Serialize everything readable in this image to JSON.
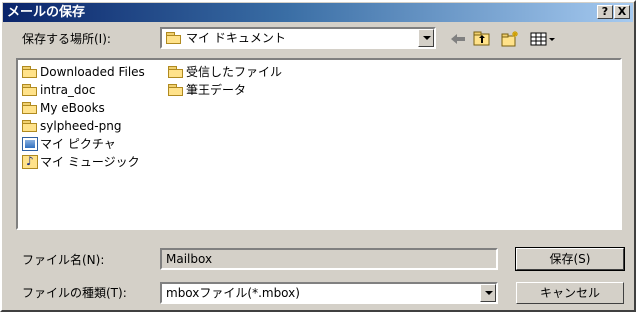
{
  "window": {
    "title": "メールの保存",
    "help_label": "?",
    "close_label": "X"
  },
  "location": {
    "label": "保存する場所(I):",
    "value": "マイ ドキュメント"
  },
  "files": [
    {
      "name": "Downloaded Files",
      "icon": "folder-icon"
    },
    {
      "name": "intra_doc",
      "icon": "folder-icon"
    },
    {
      "name": "My eBooks",
      "icon": "folder-icon"
    },
    {
      "name": "sylpheed-png",
      "icon": "folder-icon"
    },
    {
      "name": "マイ ピクチャ",
      "icon": "pictures-folder-icon"
    },
    {
      "name": "マイ ミュージック",
      "icon": "music-folder-icon"
    },
    {
      "name": "受信したファイル",
      "icon": "folder-icon"
    },
    {
      "name": "筆王データ",
      "icon": "folder-icon"
    }
  ],
  "filename": {
    "label": "ファイル名(N):",
    "value": "Mailbox"
  },
  "filetype": {
    "label": "ファイルの種類(T):",
    "value": "mboxファイル(*.mbox)"
  },
  "buttons": {
    "save": "保存(S)",
    "cancel": "キャンセル"
  }
}
